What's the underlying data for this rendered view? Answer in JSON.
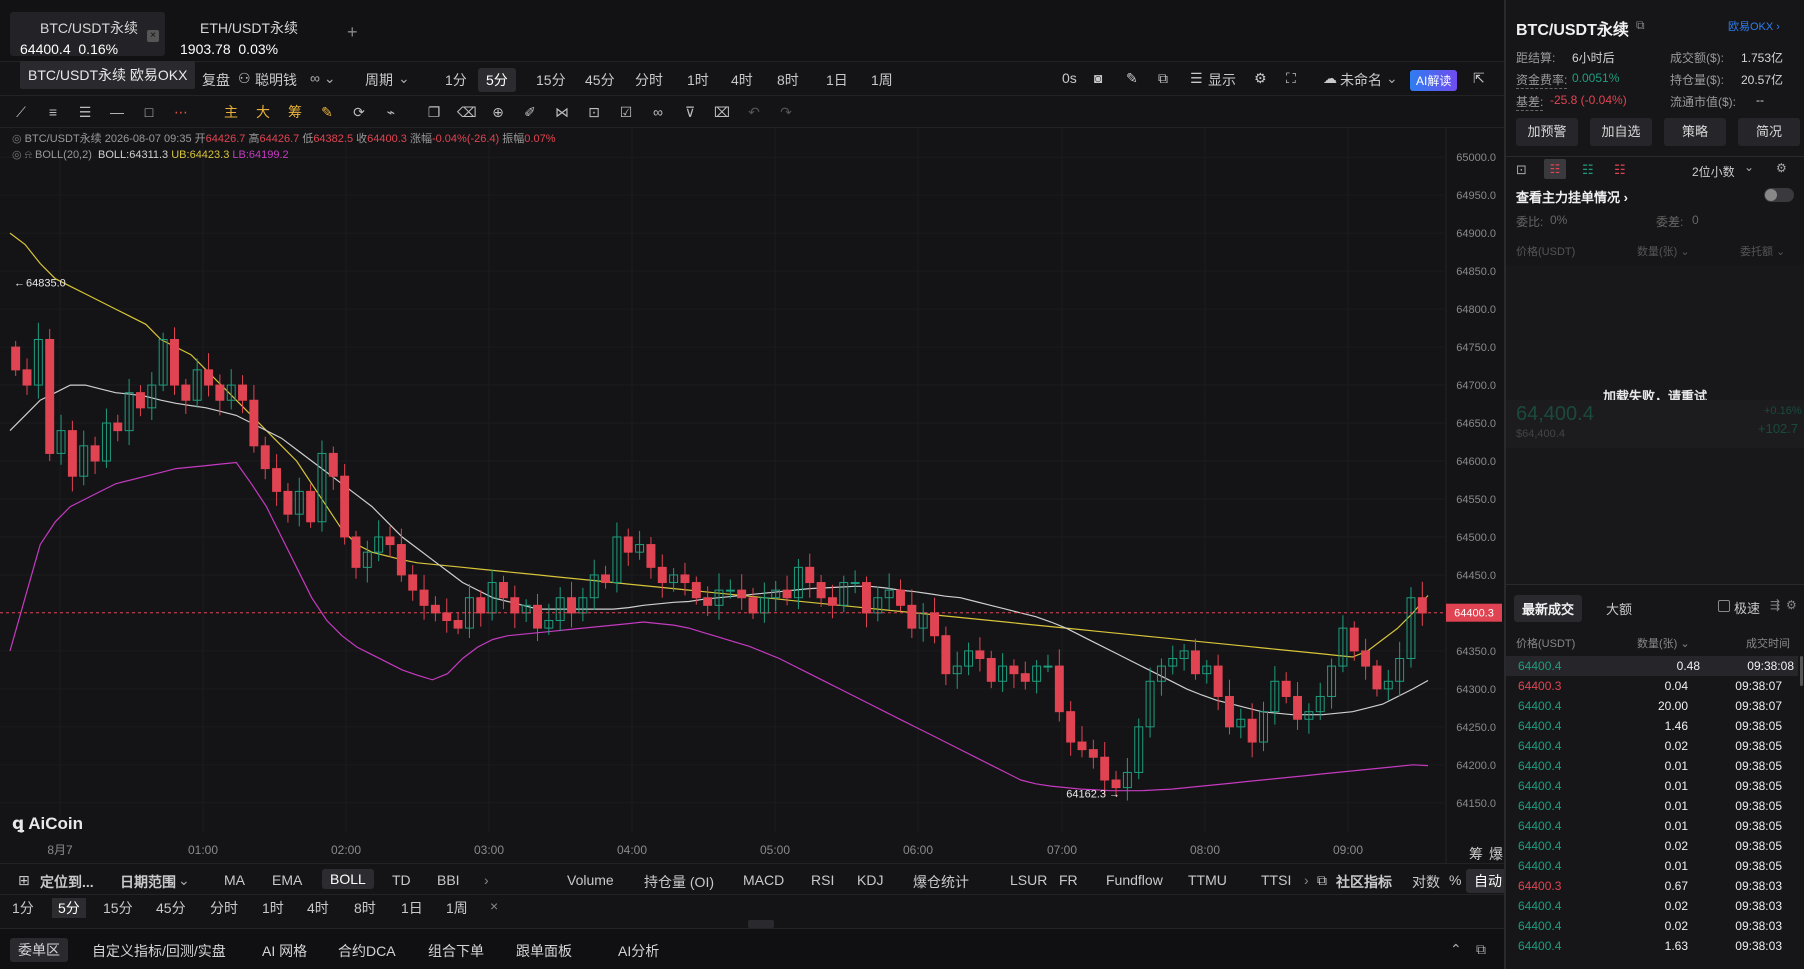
{
  "tabs": [
    {
      "name": "BTC/USDT永续",
      "price": "64400.4",
      "change": "0.16%"
    },
    {
      "name": "ETH/USDT永续",
      "price": "1903.78",
      "change": "0.03%"
    }
  ],
  "tab_add": "+",
  "tab_close": "×",
  "tooltip": "BTC/USDT永续 欧易OKX",
  "toolbar": {
    "fupan": "复盘",
    "smart_money": "聪明钱",
    "period_menu": "周期",
    "periods": [
      "1分",
      "5分",
      "15分",
      "45分",
      "分时",
      "1时",
      "4时",
      "8时",
      "1日",
      "1周"
    ],
    "selected_period": "5分",
    "right": {
      "countdown": "0s",
      "show": "显示",
      "unnamed": "未命名",
      "ai": "AI解读"
    }
  },
  "drawing_tools": {
    "main": "主",
    "big": "大",
    "chips": "筹"
  },
  "legend": {
    "line1": {
      "symbol": "BTC/USDT永续",
      "time": "2026-08-07 09:35",
      "open_label": "开",
      "open": "64426.7",
      "high_label": "高",
      "high": "64426.7",
      "low_label": "低",
      "low": "64382.5",
      "close_label": "收",
      "close": "64400.3",
      "chg_label": "涨幅",
      "chg": "-0.04%(-26.4)",
      "amp_label": "振幅",
      "amp": "0.07%"
    },
    "line2": {
      "ind": "BOLL(20,2)",
      "boll": "BOLL:64311.3",
      "ub": "UB:64423.3",
      "lb": "LB:64199.2"
    }
  },
  "chart_data": {
    "type": "candlestick",
    "symbol": "BTC/USDT永续",
    "interval": "5分",
    "ylim": [
      64130,
      65020
    ],
    "y_ticks": [
      "65000.0",
      "64950.0",
      "64900.0",
      "64850.0",
      "64800.0",
      "64750.0",
      "64700.0",
      "64650.0",
      "64600.0",
      "64550.0",
      "64500.0",
      "64450.0",
      "64400.0",
      "64350.0",
      "64300.0",
      "64250.0",
      "64200.0",
      "64150.0"
    ],
    "x_ticks": [
      "8月7",
      "01:00",
      "02:00",
      "03:00",
      "04:00",
      "05:00",
      "06:00",
      "07:00",
      "08:00",
      "09:00"
    ],
    "last_price": "64400.3",
    "high_marker": "64835.0",
    "low_marker": "64162.3",
    "colors": {
      "up": "#1f9c7e",
      "down": "#e04452",
      "ub": "#d8c43a",
      "boll": "#cfcfcf",
      "lb": "#c43ac0"
    },
    "close": [
      64720,
      64700,
      64760,
      64610,
      64640,
      64580,
      64620,
      64600,
      64650,
      64640,
      64690,
      64670,
      64700,
      64760,
      64700,
      64680,
      64720,
      64700,
      64680,
      64700,
      64680,
      64620,
      64590,
      64560,
      64530,
      64560,
      64520,
      64610,
      64580,
      64500,
      64460,
      64480,
      64500,
      64490,
      64450,
      64430,
      64410,
      64400,
      64390,
      64380,
      64420,
      64400,
      64440,
      64420,
      64400,
      64410,
      64380,
      64390,
      64420,
      64400,
      64420,
      64450,
      64440,
      64500,
      64480,
      64490,
      64460,
      64440,
      64450,
      64440,
      64420,
      64410,
      64430,
      64430,
      64420,
      64400,
      64420,
      64430,
      64420,
      64460,
      64440,
      64420,
      64410,
      64440,
      64440,
      64400,
      64420,
      64430,
      64410,
      64380,
      64400,
      64370,
      64320,
      64330,
      64350,
      64340,
      64310,
      64330,
      64320,
      64310,
      64330,
      64330,
      64270,
      64230,
      64220,
      64210,
      64180,
      64170,
      64190,
      64250,
      64310,
      64330,
      64340,
      64350,
      64320,
      64330,
      64290,
      64250,
      64260,
      64230,
      64270,
      64310,
      64290,
      64260,
      64270,
      64290,
      64330,
      64380,
      64350,
      64330,
      64300,
      64310,
      64340,
      64420,
      64400
    ],
    "boll": [
      64640,
      64660,
      64680,
      64690,
      64700,
      64700,
      64695,
      64690,
      64688,
      64685,
      64680,
      64676,
      64673,
      64670,
      64665,
      64660,
      64650,
      64640,
      64630,
      64615,
      64600,
      64585,
      64570,
      64555,
      64540,
      64520,
      64500,
      64485,
      64470,
      64455,
      64440,
      64430,
      64420,
      64415,
      64410,
      64405,
      64405,
      64405,
      64405,
      64405,
      64405,
      64407,
      64410,
      64412,
      64414,
      64415,
      64418,
      64420,
      64422,
      64424,
      64426,
      64428,
      64430,
      64432,
      64433,
      64434,
      64435,
      64435,
      64433,
      64430,
      64428,
      64425,
      64422,
      64420,
      64415,
      64410,
      64405,
      64400,
      64395,
      64388,
      64380,
      64370,
      64360,
      64350,
      64340,
      64330,
      64320,
      64310,
      64300,
      64292,
      64285,
      64280,
      64275,
      64270,
      64268,
      64266,
      64266,
      64266,
      64268,
      64270,
      64275,
      64280,
      64290,
      64300,
      64311
    ],
    "ub": [
      64900,
      64885,
      64860,
      64840,
      64830,
      64820,
      64810,
      64800,
      64790,
      64780,
      64760,
      64750,
      64740,
      64720,
      64700,
      64680,
      64660,
      64640,
      64620,
      64600,
      64570,
      64540,
      64510,
      64490,
      64480,
      64475,
      64470,
      64466,
      64464,
      64462,
      64460,
      64458,
      64456,
      64454,
      64452,
      64450,
      64448,
      64446,
      64444,
      64442,
      64440,
      64438,
      64436,
      64434,
      64432,
      64430,
      64428,
      64426,
      64424,
      64422,
      64420,
      64418,
      64416,
      64414,
      64412,
      64410,
      64408,
      64406,
      64404,
      64402,
      64400,
      64398,
      64396,
      64394,
      64392,
      64390,
      64388,
      64386,
      64384,
      64382,
      64380,
      64378,
      64376,
      64374,
      64372,
      64370,
      64368,
      64366,
      64364,
      64362,
      64360,
      64358,
      64356,
      64354,
      64352,
      64350,
      64348,
      64346,
      64344,
      64342,
      64350,
      64365,
      64380,
      64400,
      64423
    ],
    "lb": [
      64350,
      64420,
      64490,
      64520,
      64540,
      64550,
      64560,
      64570,
      64575,
      64580,
      64585,
      64590,
      64592,
      64594,
      64596,
      64598,
      64570,
      64540,
      64500,
      64460,
      64420,
      64390,
      64370,
      64355,
      64345,
      64335,
      64325,
      64318,
      64312,
      64320,
      64340,
      64355,
      64365,
      64370,
      64372,
      64374,
      64376,
      64378,
      64380,
      64382,
      64384,
      64386,
      64388,
      64386,
      64384,
      64380,
      64374,
      64368,
      64362,
      64356,
      64348,
      64340,
      64330,
      64320,
      64310,
      64300,
      64290,
      64280,
      64270,
      64260,
      64250,
      64240,
      64230,
      64220,
      64210,
      64200,
      64190,
      64180,
      64175,
      64172,
      64170,
      64168,
      64167,
      64166,
      64166,
      64166,
      64167,
      64168,
      64170,
      64172,
      64174,
      64176,
      64178,
      64180,
      64182,
      64184,
      64186,
      64188,
      64190,
      64192,
      64194,
      64196,
      64198,
      64200,
      64199
    ]
  },
  "bottom": {
    "locate": "定位到...",
    "date_range": "日期范围",
    "indicators": [
      "MA",
      "EMA",
      "BOLL",
      "TD",
      "BBI"
    ],
    "selected_indicator": "BOLL",
    "sub_indicators": [
      "Volume",
      "持仓量 (OI)",
      "MACD",
      "RSI",
      "KDJ",
      "爆仓统计",
      "LSUR",
      "FR",
      "Fundflow",
      "TTMU",
      "TTSI"
    ],
    "community": "社区指标",
    "log": "对数",
    "pct": "%",
    "auto": "自动",
    "chips": "筹",
    "boom": "爆",
    "periods": [
      "1分",
      "5分",
      "15分",
      "45分",
      "分时",
      "1时",
      "4时",
      "8时",
      "1日",
      "1周"
    ],
    "selected_period": "5分",
    "close_x": "×",
    "panel_tabs": [
      "委单区",
      "自定义指标/回测/实盘",
      "AI 网格",
      "合约DCA",
      "组合下单",
      "跟单面板",
      "AI分析"
    ]
  },
  "logo": "AiCoin",
  "right": {
    "title": "BTC/USDT永续",
    "exchange": "欧易OKX",
    "stats": [
      {
        "label": "距结算:",
        "value": "6小时后"
      },
      {
        "label": "成交额($):",
        "value": "1.753亿"
      },
      {
        "label": "资金费率:",
        "value": "0.0051%"
      },
      {
        "label": "持仓量($):",
        "value": "20.57亿"
      },
      {
        "label": "基差:",
        "value": "-25.8 (-0.04%)"
      },
      {
        "label": "流通市值($):",
        "value": "--"
      }
    ],
    "buttons": [
      "加预警",
      "加自选",
      "策略",
      "简况"
    ],
    "decimals": "2位小数",
    "orderbook_link": "查看主力挂单情况",
    "weibi_label": "委比:",
    "weibi": "0%",
    "weicha_label": "委差:",
    "weicha": "0",
    "book_headers": [
      "价格(USDT)",
      "数量(张)",
      "委托额"
    ],
    "error": "加载失败，请重试",
    "mid_price": "64,400.4",
    "mid_sub": "$64,400.4",
    "mid_pct": "+0.16%",
    "mid_chg": "+102.7",
    "trade_tabs": [
      "最新成交",
      "大额"
    ],
    "fast": "极速",
    "trade_headers": [
      "价格(USDT)",
      "数量(张)",
      "成交时间"
    ],
    "trades": [
      {
        "p": "64400.4",
        "q": "0.48",
        "t": "09:38:08",
        "s": "buy"
      },
      {
        "p": "64400.3",
        "q": "0.04",
        "t": "09:38:07",
        "s": "sell"
      },
      {
        "p": "64400.4",
        "q": "20.00",
        "t": "09:38:07",
        "s": "buy"
      },
      {
        "p": "64400.4",
        "q": "1.46",
        "t": "09:38:05",
        "s": "buy"
      },
      {
        "p": "64400.4",
        "q": "0.02",
        "t": "09:38:05",
        "s": "buy"
      },
      {
        "p": "64400.4",
        "q": "0.01",
        "t": "09:38:05",
        "s": "buy"
      },
      {
        "p": "64400.4",
        "q": "0.01",
        "t": "09:38:05",
        "s": "buy"
      },
      {
        "p": "64400.4",
        "q": "0.01",
        "t": "09:38:05",
        "s": "buy"
      },
      {
        "p": "64400.4",
        "q": "0.01",
        "t": "09:38:05",
        "s": "buy"
      },
      {
        "p": "64400.4",
        "q": "0.02",
        "t": "09:38:05",
        "s": "buy"
      },
      {
        "p": "64400.4",
        "q": "0.01",
        "t": "09:38:05",
        "s": "buy"
      },
      {
        "p": "64400.3",
        "q": "0.67",
        "t": "09:38:03",
        "s": "sell"
      },
      {
        "p": "64400.4",
        "q": "0.02",
        "t": "09:38:03",
        "s": "buy"
      },
      {
        "p": "64400.4",
        "q": "0.02",
        "t": "09:38:03",
        "s": "buy"
      },
      {
        "p": "64400.4",
        "q": "1.63",
        "t": "09:38:03",
        "s": "buy"
      }
    ]
  }
}
